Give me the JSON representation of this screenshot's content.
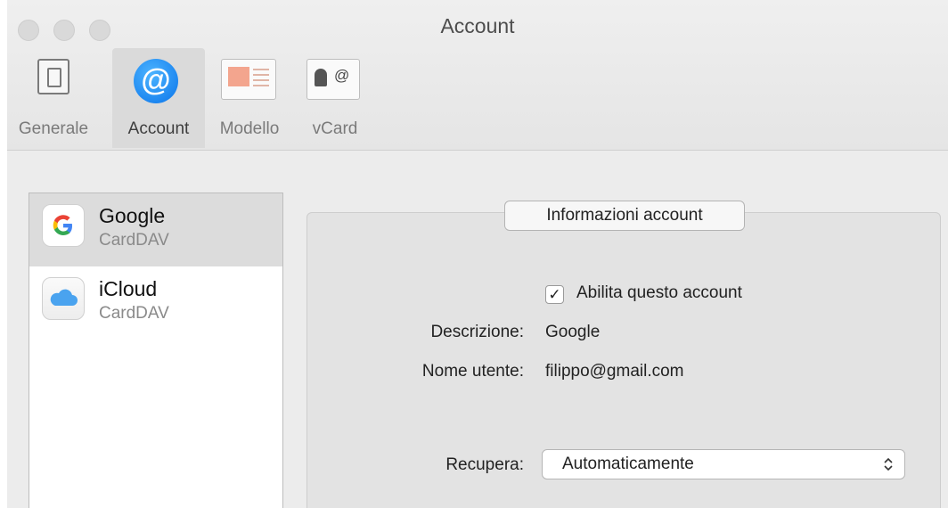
{
  "window": {
    "title": "Account"
  },
  "toolbar": {
    "items": [
      {
        "label": "Generale",
        "icon": "general-switch-icon",
        "selected": false
      },
      {
        "label": "Account",
        "icon": "at-sign-icon",
        "selected": true
      },
      {
        "label": "Modello",
        "icon": "template-icon",
        "selected": false
      },
      {
        "label": "vCard",
        "icon": "vcard-icon",
        "selected": false
      }
    ]
  },
  "accounts": [
    {
      "name": "Google",
      "type": "CardDAV",
      "icon": "google-logo-icon",
      "selected": true
    },
    {
      "name": "iCloud",
      "type": "CardDAV",
      "icon": "icloud-icon",
      "selected": false
    }
  ],
  "details": {
    "section_title": "Informazioni account",
    "enable_label": "Abilita questo account",
    "enable_checked": true,
    "description_label": "Descrizione:",
    "description_value": "Google",
    "username_label": "Nome utente:",
    "username_value": "filippo@gmail.com",
    "fetch_label": "Recupera:",
    "fetch_value": "Automaticamente"
  },
  "colors": {
    "accent": "#1b86f0",
    "selected_row": "#dcdcdc"
  }
}
